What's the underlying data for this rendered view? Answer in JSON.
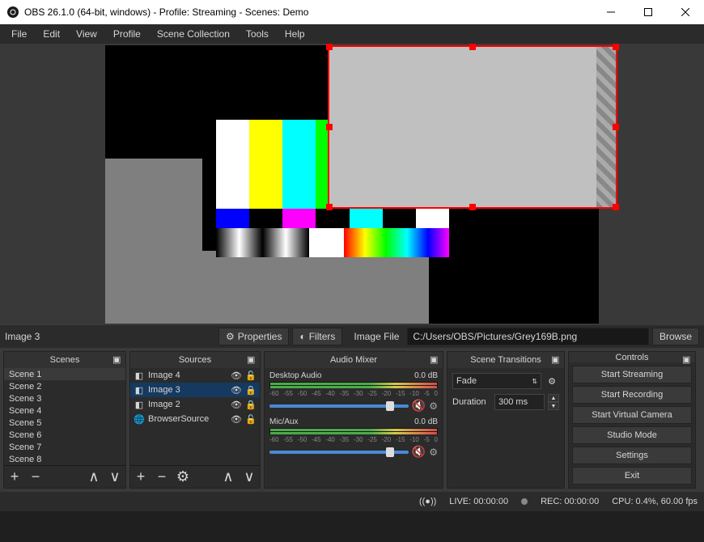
{
  "title": "OBS 26.1.0 (64-bit, windows) - Profile: Streaming - Scenes: Demo",
  "menu": [
    "File",
    "Edit",
    "View",
    "Profile",
    "Scene Collection",
    "Tools",
    "Help"
  ],
  "context": {
    "selected": "Image 3",
    "properties": "Properties",
    "filters": "Filters",
    "field_label": "Image File",
    "path": "C:/Users/OBS/Pictures/Grey169B.png",
    "browse": "Browse"
  },
  "panels": {
    "scenes": "Scenes",
    "sources": "Sources",
    "mixer": "Audio Mixer",
    "transitions": "Scene Transitions",
    "controls": "Controls"
  },
  "scenes": [
    "Scene 1",
    "Scene 2",
    "Scene 3",
    "Scene 4",
    "Scene 5",
    "Scene 6",
    "Scene 7",
    "Scene 8"
  ],
  "scene_selected_index": 0,
  "sources": [
    {
      "name": "Image 4",
      "icon": "image",
      "visible": true,
      "locked": false
    },
    {
      "name": "Image 3",
      "icon": "image",
      "visible": true,
      "locked": true
    },
    {
      "name": "Image 2",
      "icon": "image",
      "visible": true,
      "locked": true
    },
    {
      "name": "BrowserSource",
      "icon": "globe",
      "visible": true,
      "locked": false
    }
  ],
  "source_selected_index": 1,
  "mixer": {
    "channels": [
      {
        "name": "Desktop Audio",
        "db": "0.0 dB"
      },
      {
        "name": "Mic/Aux",
        "db": "0.0 dB"
      }
    ],
    "ticks": [
      "-60",
      "-55",
      "-50",
      "-45",
      "-40",
      "-35",
      "-30",
      "-25",
      "-20",
      "-15",
      "-10",
      "-5",
      "0"
    ]
  },
  "transitions": {
    "type": "Fade",
    "duration_label": "Duration",
    "duration": "300 ms"
  },
  "controls": [
    "Start Streaming",
    "Start Recording",
    "Start Virtual Camera",
    "Studio Mode",
    "Settings",
    "Exit"
  ],
  "status": {
    "live": "LIVE: 00:00:00",
    "rec": "REC: 00:00:00",
    "cpu": "CPU: 0.4%, 60.00 fps"
  }
}
